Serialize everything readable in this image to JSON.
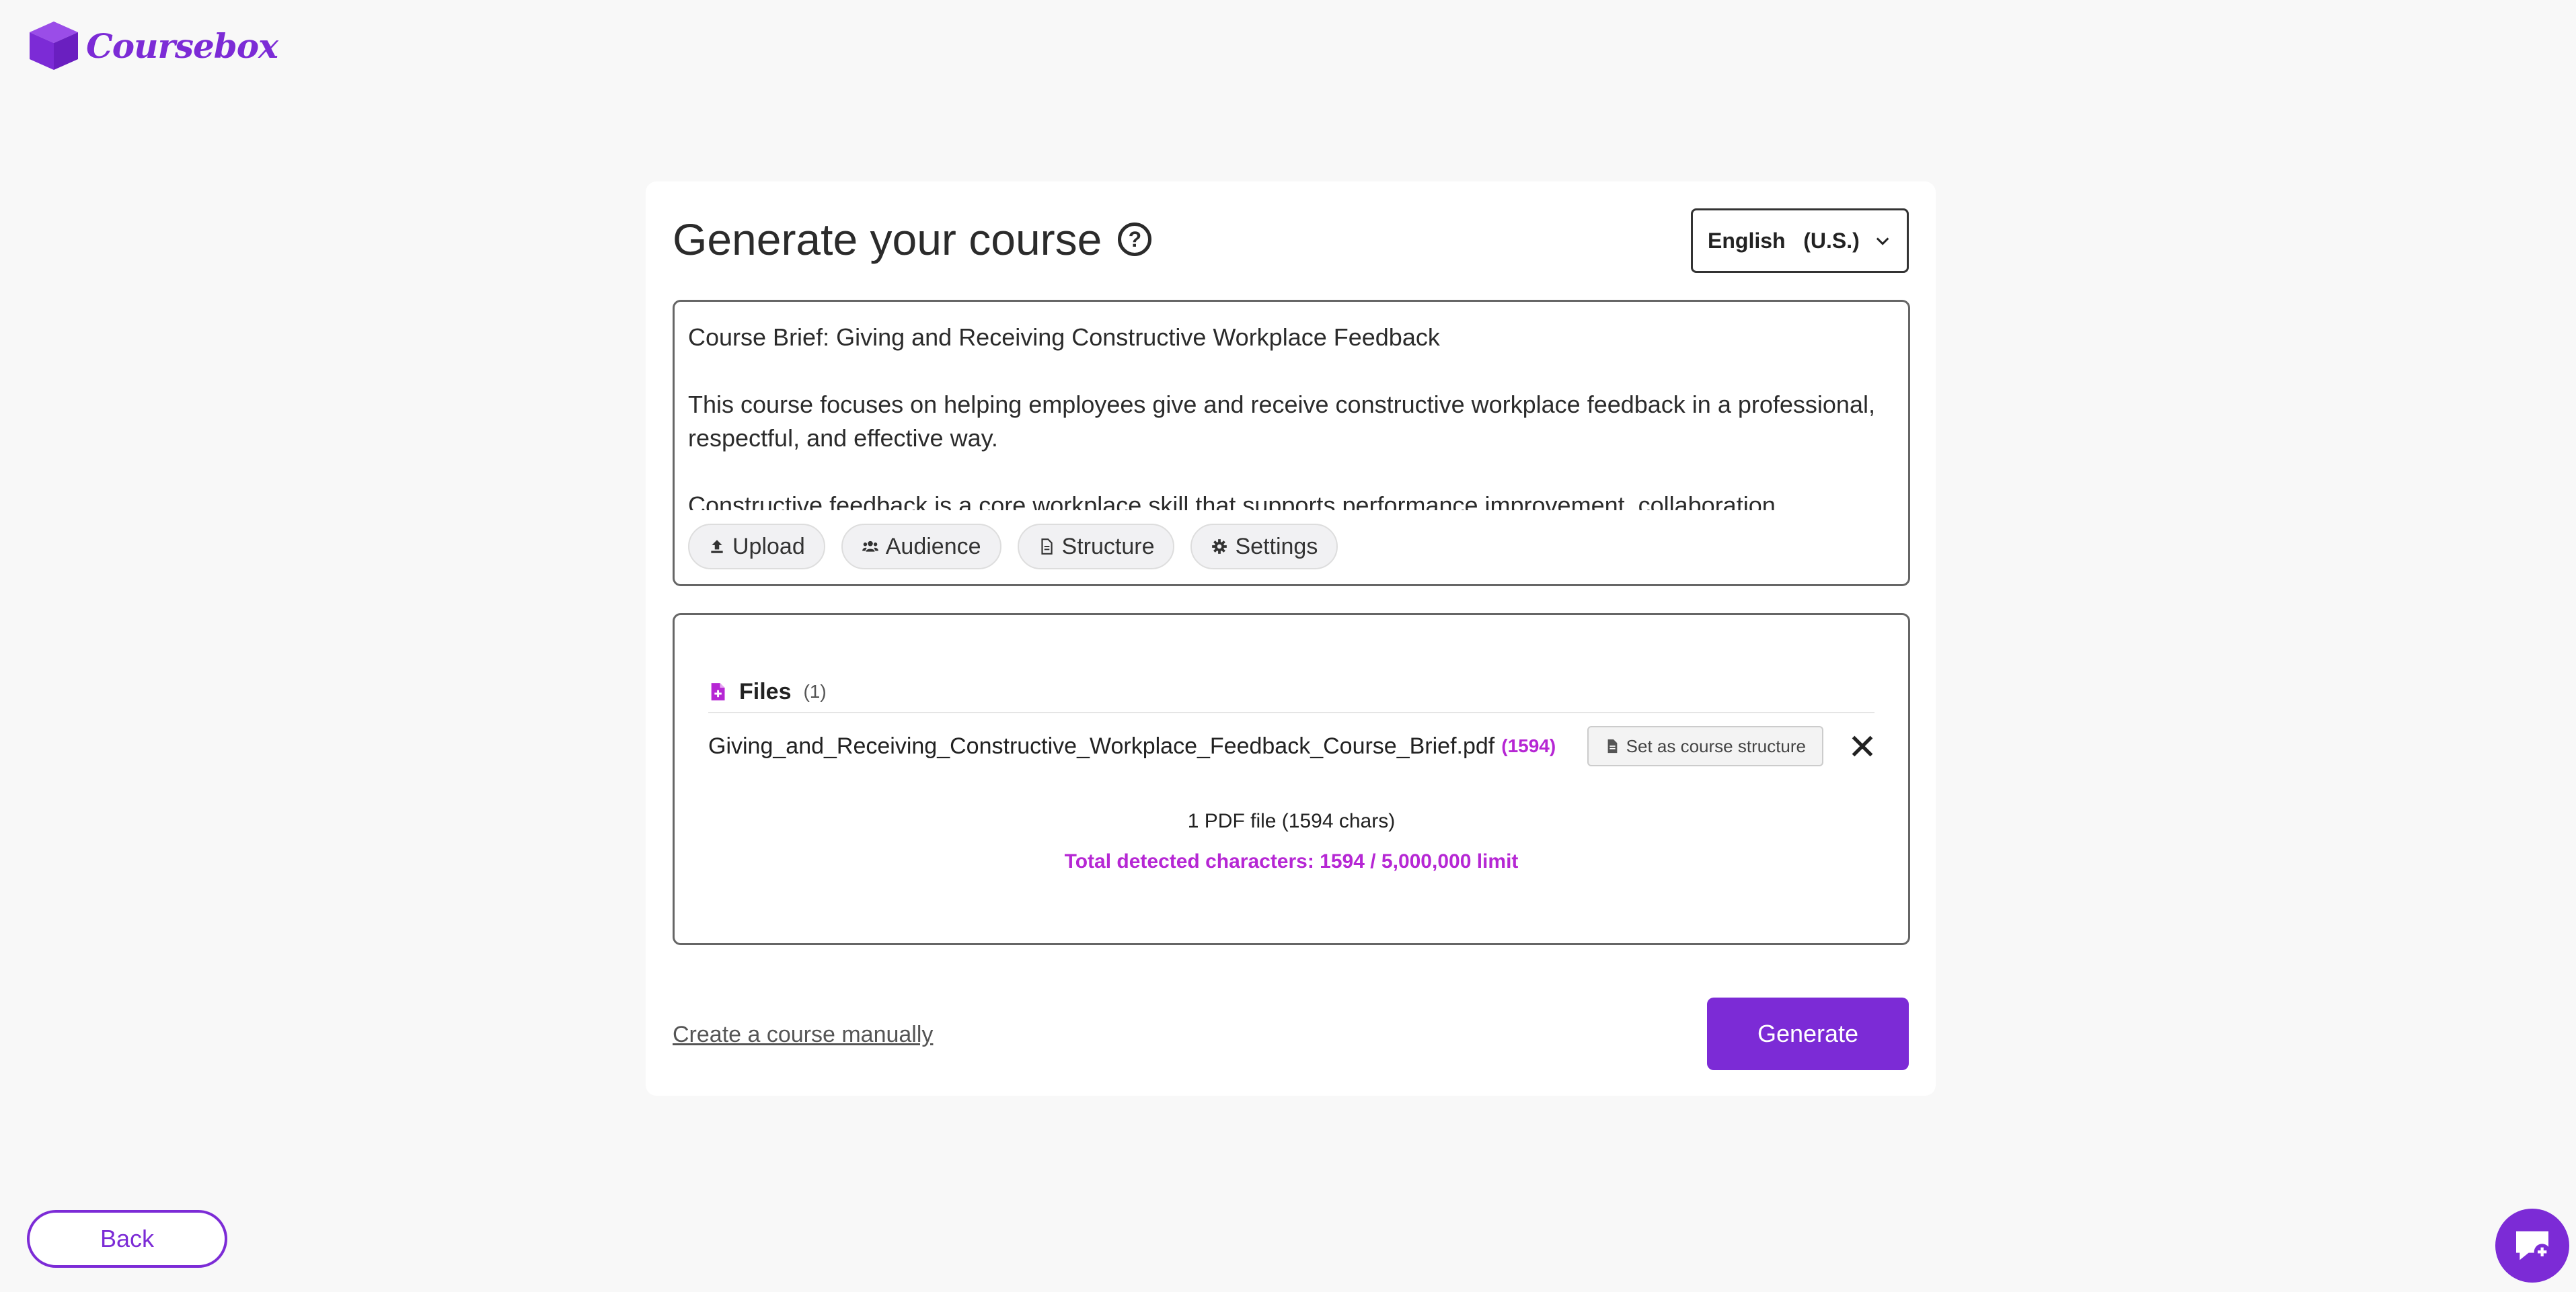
{
  "brand": {
    "name": "Coursebox",
    "accent_color": "#7c2bd6",
    "highlight_color": "#b627d4"
  },
  "header": {
    "title": "Generate your course",
    "help_icon": "question-circle-icon",
    "language": {
      "selected": "English   (U.S.)",
      "icon": "chevron-down-icon"
    }
  },
  "prompt": {
    "text": "Course Brief: Giving and Receiving Constructive Workplace Feedback\n\nThis course focuses on helping employees give and receive constructive workplace feedback in a professional, respectful, and effective way.\n\nConstructive feedback is a core workplace skill that supports performance improvement, collaboration",
    "chips": [
      {
        "label": "Upload",
        "icon": "upload-icon"
      },
      {
        "label": "Audience",
        "icon": "users-icon"
      },
      {
        "label": "Structure",
        "icon": "document-icon"
      },
      {
        "label": "Settings",
        "icon": "gear-icon"
      }
    ]
  },
  "files": {
    "label": "Files",
    "count": "(1)",
    "items": [
      {
        "name": "Giving_and_Receiving_Constructive_Workplace_Feedback_Course_Brief.pdf",
        "chars": "(1594)",
        "action_label": "Set as course structure"
      }
    ],
    "summary": "1 PDF file (1594 chars)",
    "total": "Total detected characters: 1594 / 5,000,000 limit"
  },
  "actions": {
    "manual_link": "Create a course manually",
    "generate_label": "Generate",
    "back_label": "Back"
  }
}
